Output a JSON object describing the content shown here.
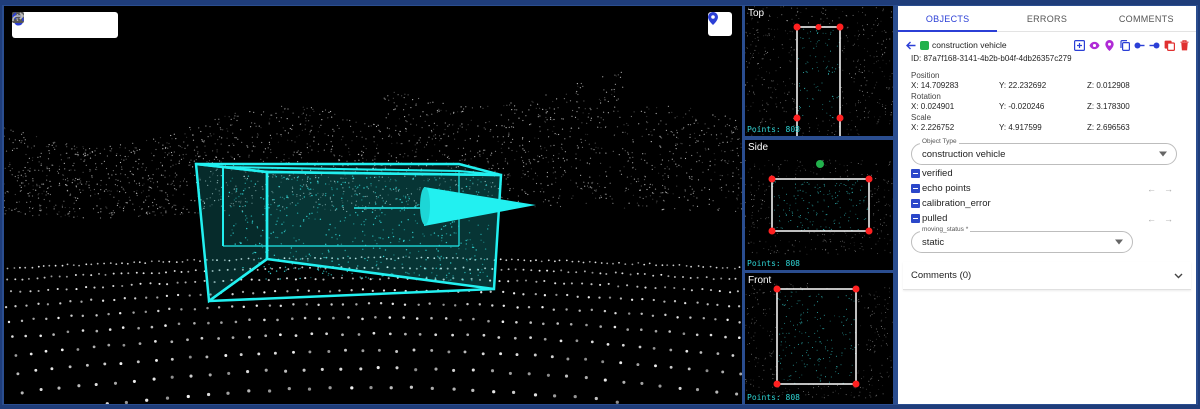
{
  "toolbar": {
    "tools": [
      {
        "name": "hand-tool-icon",
        "active": true
      },
      {
        "name": "add-box-icon",
        "active": false
      },
      {
        "name": "add-frame-icon",
        "active": false
      },
      {
        "name": "undo-icon",
        "active": false
      },
      {
        "name": "redo-icon",
        "active": false
      }
    ],
    "locate": "location-pin-icon"
  },
  "views": {
    "top": {
      "title": "Top",
      "points": "Points: 808"
    },
    "side": {
      "title": "Side",
      "points": "Points: 808"
    },
    "front": {
      "title": "Front",
      "points": "Points: 808"
    }
  },
  "panel": {
    "tabs": [
      "OBJECTS",
      "ERRORS",
      "COMMENTS"
    ],
    "active_tab": "OBJECTS",
    "object": {
      "label": "construction vehicle",
      "color": "#22b14c",
      "id": "ID: 87a7f168-3141-4b2b-b04f-4db26357c279",
      "actions": [
        "add-icon",
        "eye-icon",
        "pin-icon",
        "copy-icon",
        "propagate-forward-icon",
        "propagate-back-icon",
        "paste-icon",
        "delete-icon"
      ]
    },
    "position": {
      "label": "Position",
      "x": "X: 14.709283",
      "y": "Y: 22.232692",
      "z": "Z: 0.012908"
    },
    "rotation": {
      "label": "Rotation",
      "x": "X: 0.024901",
      "y": "Y: -0.020246",
      "z": "Z: 3.178300"
    },
    "scale": {
      "label": "Scale",
      "x": "X: 2.226752",
      "y": "Y: 4.917599",
      "z": "Z: 2.696563"
    },
    "object_type": {
      "legend": "Object Type",
      "value": "construction vehicle"
    },
    "checkboxes": [
      {
        "label": "verified",
        "arrows": false
      },
      {
        "label": "echo points",
        "arrows": true
      },
      {
        "label": "calibration_error",
        "arrows": false
      },
      {
        "label": "pulled",
        "arrows": true
      }
    ],
    "moving_status": {
      "legend": "moving_status *",
      "value": "static"
    },
    "comments": "Comments (0)"
  },
  "colors": {
    "accent": "#2b3fd6",
    "box": "#22f0f0",
    "corner": "#ff2020"
  }
}
